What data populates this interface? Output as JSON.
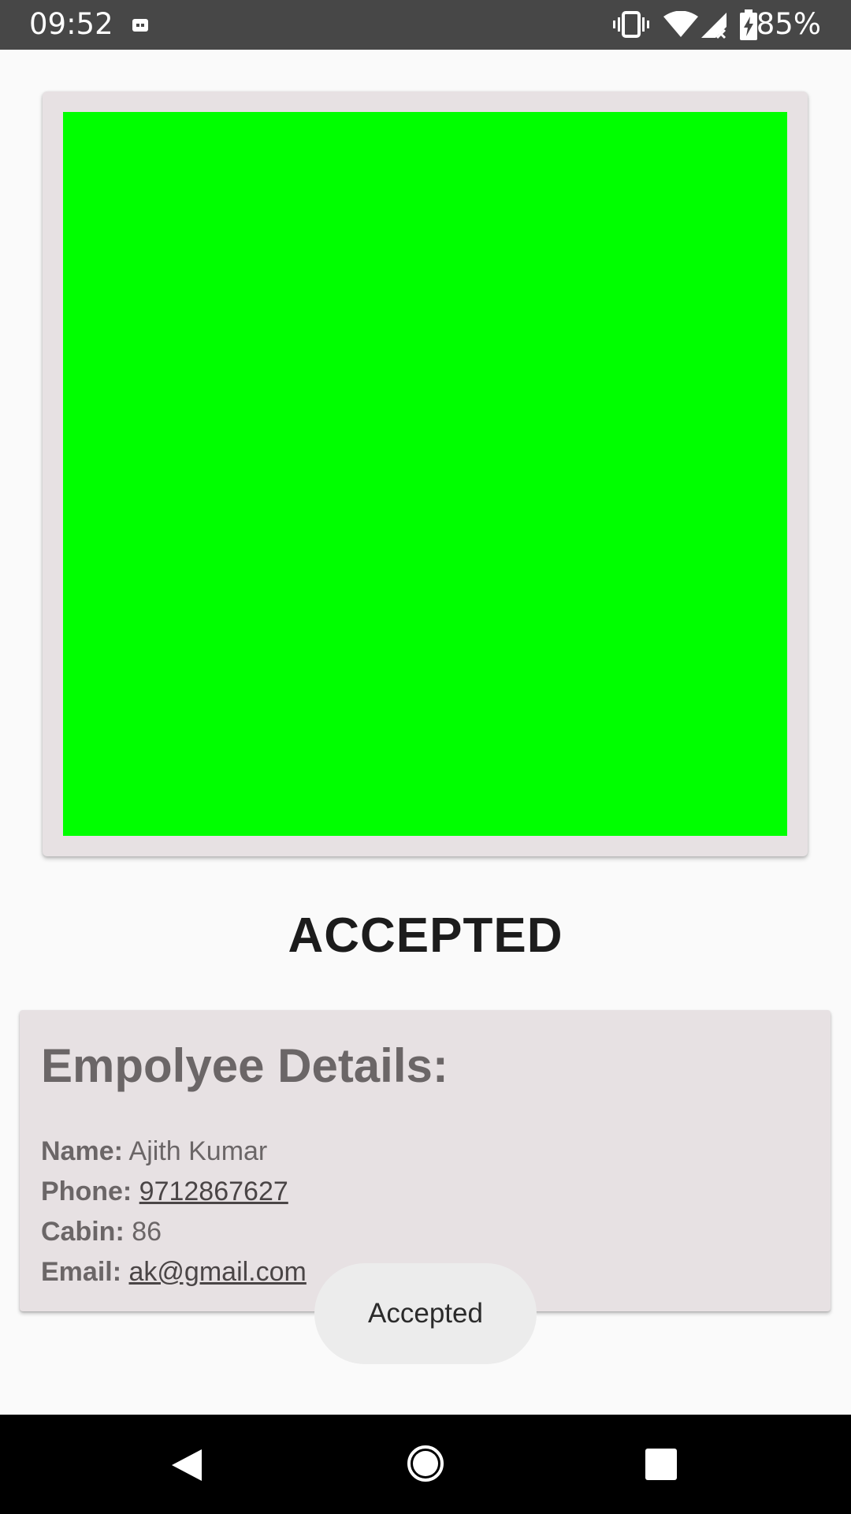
{
  "status_bar": {
    "time": "09:52",
    "battery_percent": "85%",
    "icons": [
      "notification-icon",
      "vibrate-icon",
      "wifi-icon",
      "cell-signal-icon",
      "battery-charging-icon"
    ]
  },
  "qr_card": {
    "image_color": "#00ff00"
  },
  "status": {
    "heading": "ACCEPTED"
  },
  "employee": {
    "title": "Empolyee Details:",
    "name_label": "Name:",
    "name_value": "Ajith Kumar",
    "phone_label": "Phone:",
    "phone_value": "9712867627",
    "cabin_label": "Cabin:",
    "cabin_value": "86",
    "email_label": "Email:",
    "email_value": "ak@gmail.com"
  },
  "toast": {
    "message": "Accepted"
  },
  "nav_bar": {
    "buttons": [
      "back-icon",
      "home-icon",
      "recents-icon"
    ]
  }
}
